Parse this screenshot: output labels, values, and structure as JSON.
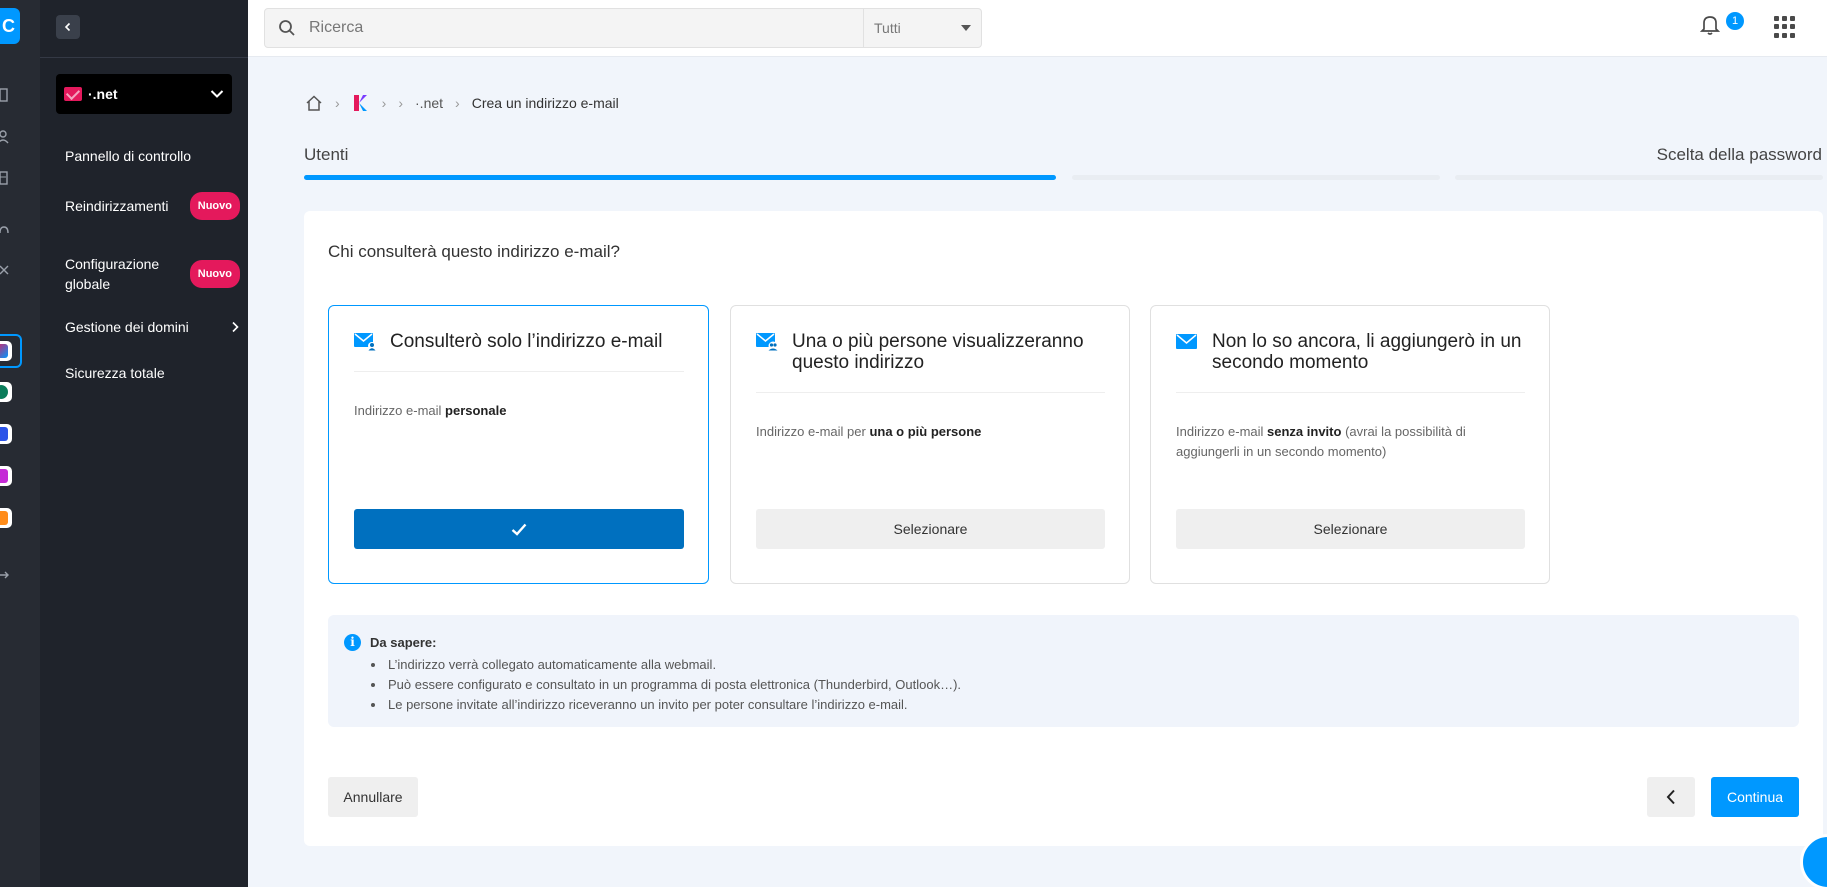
{
  "rail": {
    "brand_letter": "C"
  },
  "sidebar": {
    "product_name": "·.net",
    "items": [
      {
        "label": "Pannello di controllo"
      },
      {
        "label": "Reindirizzamenti",
        "badge": "Nuovo"
      },
      {
        "label": "Configurazione globale",
        "badge": "Nuovo"
      },
      {
        "label": "Gestione dei domini"
      },
      {
        "label": "Sicurezza totale"
      }
    ]
  },
  "topbar": {
    "search_placeholder": "Ricerca",
    "search_scope": "Tutti",
    "notification_count": "1"
  },
  "breadcrumb": {
    "domain": "·.net",
    "current": "Crea un indirizzo e-mail"
  },
  "steps": [
    {
      "label": "Utenti",
      "state": "active"
    },
    {
      "label": "",
      "state": "pending"
    },
    {
      "label": "Scelta della password",
      "state": "pending"
    }
  ],
  "colors": {
    "accent": "#0098ff",
    "selected_button": "#0070bf",
    "badge": "#e4195c"
  },
  "main": {
    "question": "Chi consulterà questo indirizzo e-mail?",
    "options": [
      {
        "title": "Consulterò solo l’indirizzo e-mail",
        "desc_prefix": "Indirizzo e-mail ",
        "desc_bold": "personale",
        "desc_suffix": "",
        "selected": true,
        "button_icon": "check-icon"
      },
      {
        "title": "Una o più persone visualizzeranno questo indirizzo",
        "desc_prefix": "Indirizzo e-mail per ",
        "desc_bold": "una o più persone",
        "desc_suffix": "",
        "selected": false,
        "button_label": "Selezionare"
      },
      {
        "title": "Non lo so ancora, li aggiungerò in un secondo momento",
        "desc_prefix": "Indirizzo e-mail ",
        "desc_bold": "senza invito",
        "desc_suffix": " (avrai la possibilità di aggiungerli in un secondo momento)",
        "selected": false,
        "button_label": "Selezionare"
      }
    ],
    "info": {
      "title": "Da sapere:",
      "items": [
        "L’indirizzo verrà collegato automaticamente alla webmail.",
        "Può essere configurato e consultato in un programma di posta elettronica (Thunderbird, Outlook…).",
        "Le persone invitate all’indirizzo riceveranno un invito per poter consultare l’indirizzo e-mail."
      ]
    },
    "cancel_label": "Annullare",
    "continue_label": "Continua"
  }
}
